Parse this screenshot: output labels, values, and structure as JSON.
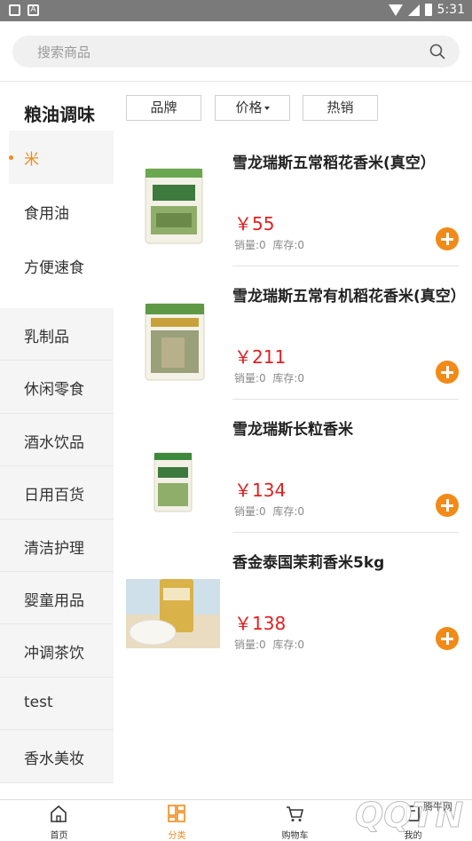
{
  "status_bar": {
    "time": "5:31"
  },
  "search": {
    "placeholder": "搜索商品"
  },
  "sidebar": {
    "title": "粮油调味",
    "sub_items": [
      {
        "label": "米",
        "active": true
      },
      {
        "label": "食用油",
        "active": false
      },
      {
        "label": "方便速食",
        "active": false
      }
    ],
    "categories": [
      "乳制品",
      "休闲零食",
      "酒水饮品",
      "日用百货",
      "清洁护理",
      "婴童用品",
      "冲调茶饮",
      "test",
      "香水美妆"
    ]
  },
  "filters": {
    "brand": "品牌",
    "price": "价格",
    "hot": "热销"
  },
  "products": [
    {
      "name": "雪龙瑞斯五常稻花香米(真空）",
      "price": "￥55",
      "sales": "销量:0",
      "stock": "库存:0"
    },
    {
      "name": "雪龙瑞斯五常有机稻花香米(真空）",
      "price": "￥211",
      "sales": "销量:0",
      "stock": "库存:0"
    },
    {
      "name": "雪龙瑞斯长粒香米",
      "price": "￥134",
      "sales": "销量:0",
      "stock": "库存:0"
    },
    {
      "name": "香金泰国茉莉香米5kg",
      "price": "￥138",
      "sales": "销量:0",
      "stock": "库存:0"
    }
  ],
  "tabbar": {
    "home": "首页",
    "category": "分类",
    "cart": "购物车",
    "mine": "我的"
  },
  "watermark": {
    "text": "QQTN",
    "small": "腾牛网"
  },
  "colors": {
    "accent": "#f08a1a",
    "price": "#e02020",
    "add_button": "#f28a17"
  }
}
